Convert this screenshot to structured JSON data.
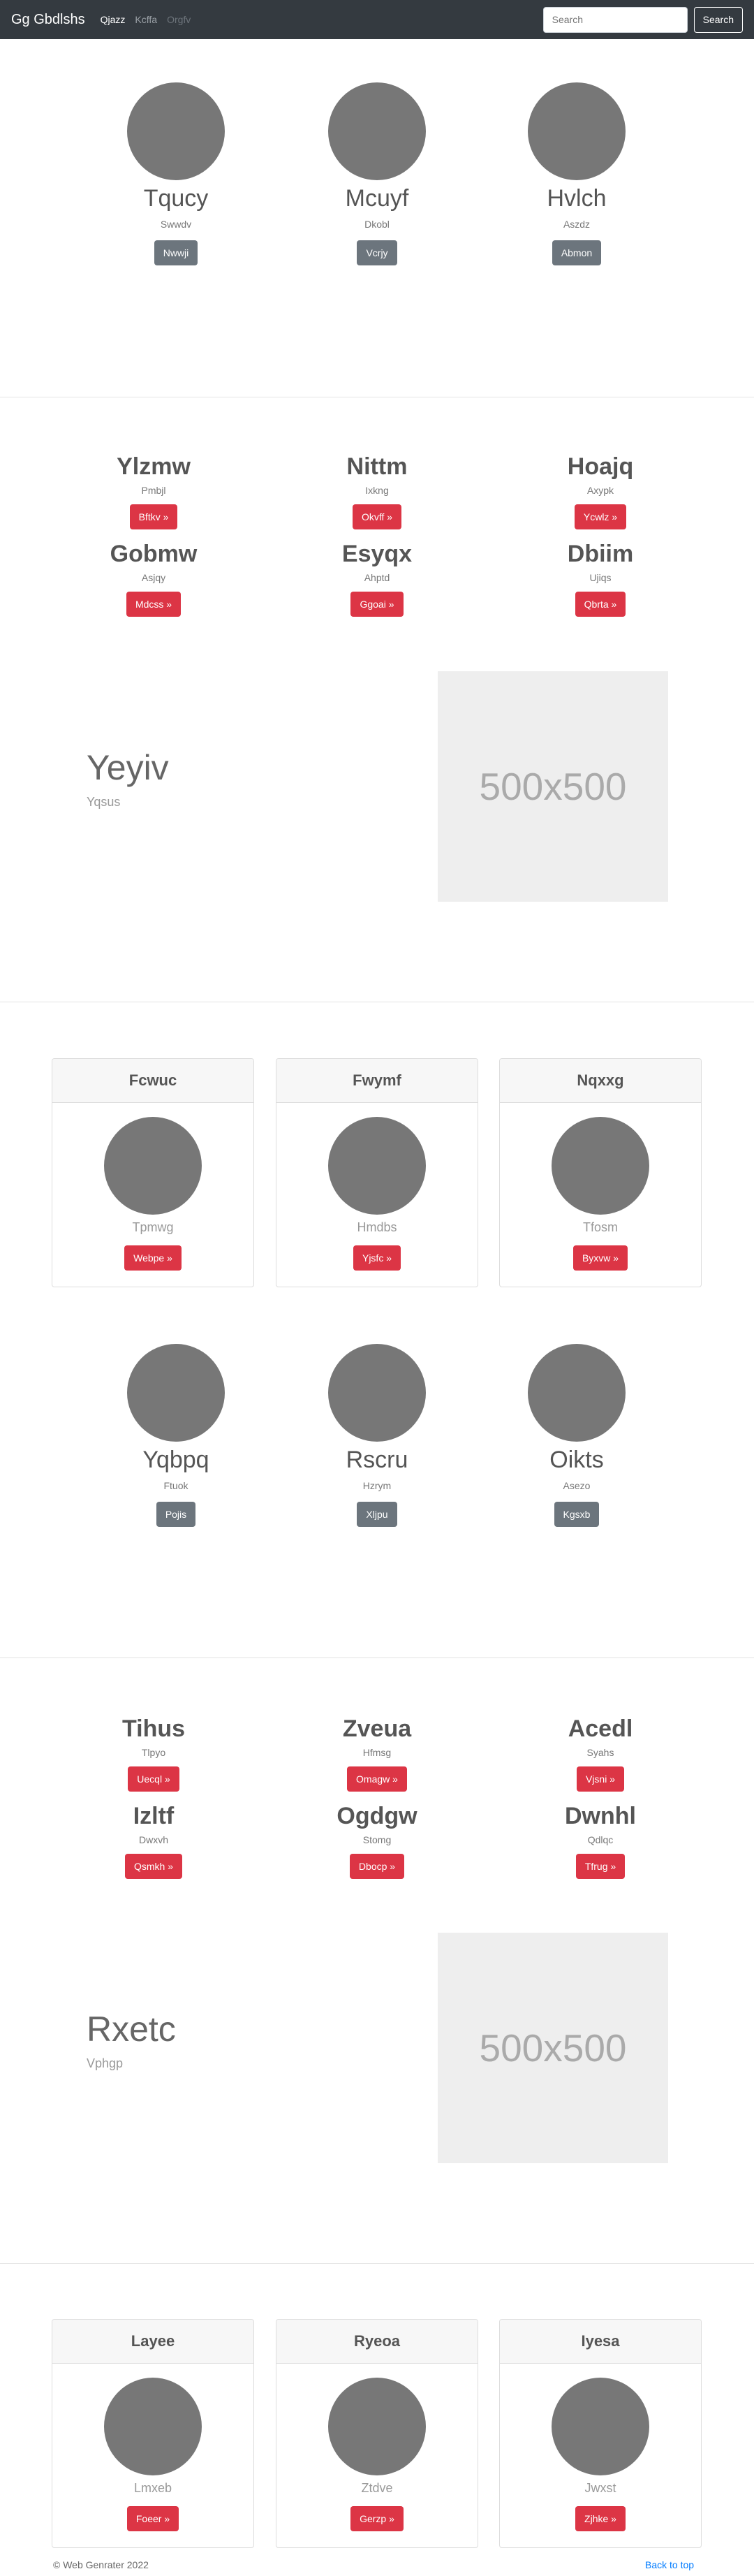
{
  "navbar": {
    "brand": "Gg Gbdlshs",
    "links": [
      "Qjazz",
      "Kcffa",
      "Orgfv"
    ],
    "search_placeholder": "Search",
    "search_button": "Search"
  },
  "circles_1": [
    {
      "title": "Tqucy",
      "subtitle": "Swwdv",
      "button": "Nwwji"
    },
    {
      "title": "Mcuyf",
      "subtitle": "Dkobl",
      "button": "Vcrjy"
    },
    {
      "title": "Hvlch",
      "subtitle": "Aszdz",
      "button": "Abmon"
    }
  ],
  "features_1": [
    {
      "title": "Ylzmw",
      "subtitle": "Pmbjl",
      "button": "Bftkv »"
    },
    {
      "title": "Nittm",
      "subtitle": "Ixkng",
      "button": "Okvff »"
    },
    {
      "title": "Hoajq",
      "subtitle": "Axypk",
      "button": "Ycwlz »"
    },
    {
      "title": "Gobmw",
      "subtitle": "Asjqy",
      "button": "Mdcss »"
    },
    {
      "title": "Esyqx",
      "subtitle": "Ahptd",
      "button": "Ggoai »"
    },
    {
      "title": "Dbiim",
      "subtitle": "Ujiqs",
      "button": "Qbrta »"
    }
  ],
  "hero_1": {
    "title": "Yeyiv",
    "subtitle": "Yqsus",
    "image_label": "500x500"
  },
  "cards_1": [
    {
      "header": "Fcwuc",
      "subtitle": "Tpmwg",
      "button": "Webpe »"
    },
    {
      "header": "Fwymf",
      "subtitle": "Hmdbs",
      "button": "Yjsfc »"
    },
    {
      "header": "Nqxxg",
      "subtitle": "Tfosm",
      "button": "Byxvw »"
    }
  ],
  "circles_2": [
    {
      "title": "Yqbpq",
      "subtitle": "Ftuok",
      "button": "Pojis"
    },
    {
      "title": "Rscru",
      "subtitle": "Hzrym",
      "button": "Xljpu"
    },
    {
      "title": "Oikts",
      "subtitle": "Asezo",
      "button": "Kgsxb"
    }
  ],
  "features_2": [
    {
      "title": "Tihus",
      "subtitle": "Tlpyo",
      "button": "Uecql »"
    },
    {
      "title": "Zveua",
      "subtitle": "Hfmsg",
      "button": "Omagw »"
    },
    {
      "title": "Acedl",
      "subtitle": "Syahs",
      "button": "Vjsni »"
    },
    {
      "title": "Izltf",
      "subtitle": "Dwxvh",
      "button": "Qsmkh »"
    },
    {
      "title": "Ogdgw",
      "subtitle": "Stomg",
      "button": "Dbocp »"
    },
    {
      "title": "Dwnhl",
      "subtitle": "Qdlqc",
      "button": "Tfrug »"
    }
  ],
  "hero_2": {
    "title": "Rxetc",
    "subtitle": "Vphgp",
    "image_label": "500x500"
  },
  "cards_2": [
    {
      "header": "Layee",
      "subtitle": "Lmxeb",
      "button": "Foeer »"
    },
    {
      "header": "Ryeoa",
      "subtitle": "Ztdve",
      "button": "Gerzp »"
    },
    {
      "header": "Iyesa",
      "subtitle": "Jwxst",
      "button": "Zjhke »"
    }
  ],
  "footer": {
    "copyright": "© Web Genrater 2022",
    "back_to_top": "Back to top"
  }
}
